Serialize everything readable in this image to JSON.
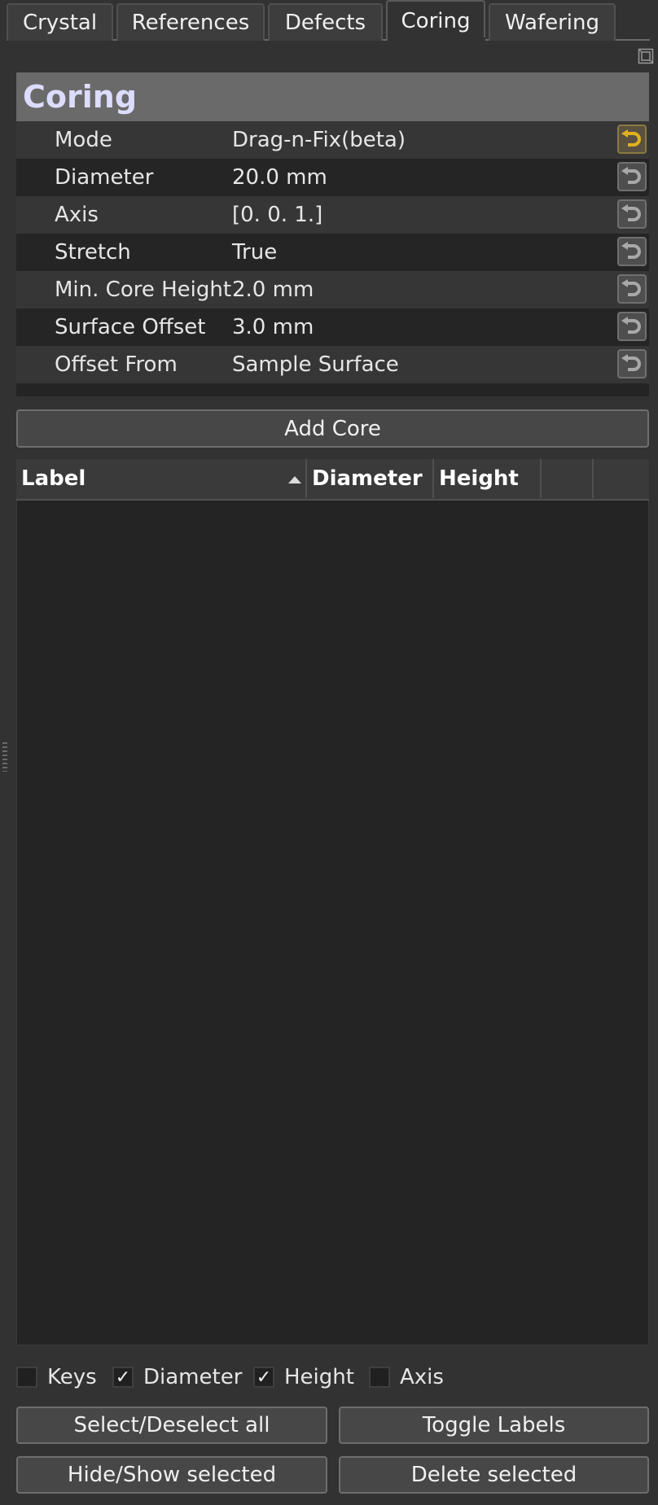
{
  "tabs": [
    {
      "label": "Crystal"
    },
    {
      "label": "References"
    },
    {
      "label": "Defects"
    },
    {
      "label": "Coring",
      "active": true
    },
    {
      "label": "Wafering"
    }
  ],
  "panel": {
    "title": "Coring",
    "properties": [
      {
        "name": "Mode",
        "value": "Drag-n-Fix(beta)",
        "reset_active": true
      },
      {
        "name": "Diameter",
        "value": "20.0 mm",
        "reset_active": false
      },
      {
        "name": "Axis",
        "value": "[0. 0. 1.]",
        "reset_active": false
      },
      {
        "name": "Stretch",
        "value": "True",
        "reset_active": false
      },
      {
        "name": "Min. Core Height",
        "value": "2.0 mm",
        "reset_active": false
      },
      {
        "name": "Surface Offset",
        "value": "3.0 mm",
        "reset_active": false
      },
      {
        "name": "Offset From",
        "value": "Sample Surface",
        "reset_active": false
      }
    ]
  },
  "add_core_label": "Add Core",
  "table": {
    "columns": [
      "Label",
      "Diameter",
      "Height",
      "",
      ""
    ],
    "sort_column": "Label",
    "rows": []
  },
  "checkboxes": [
    {
      "label": "Keys",
      "checked": false
    },
    {
      "label": "Diameter",
      "checked": true
    },
    {
      "label": "Height",
      "checked": true
    },
    {
      "label": "Axis",
      "checked": false
    }
  ],
  "checkmark": "✓",
  "buttons": {
    "select_all": "Select/Deselect all",
    "toggle_labels": "Toggle Labels",
    "hide_show": "Hide/Show selected",
    "delete": "Delete selected"
  },
  "colors": {
    "background": "#323232",
    "panel_header": "#6a6a6a",
    "title_text": "#dcdcff",
    "reset_active": "#e0b020"
  },
  "icons": {
    "reset": "undo-arrow-icon",
    "float": "undock-icon"
  }
}
